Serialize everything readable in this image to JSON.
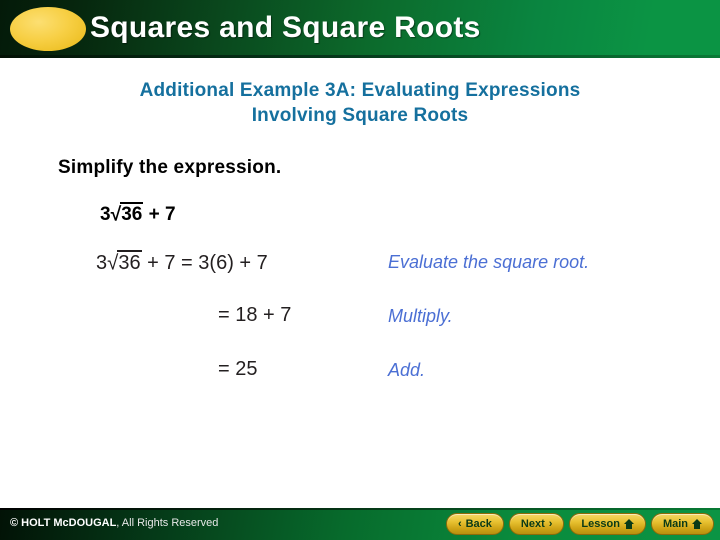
{
  "header": {
    "title": "Squares and Square Roots",
    "ellipse_color": "#f4cf45",
    "gradient_from": "#04200a",
    "gradient_to": "#0b9444"
  },
  "subtitle": {
    "line1": "Additional Example 3A: Evaluating Expressions",
    "line2": "Involving Square Roots",
    "color": "#15709e"
  },
  "lesson": {
    "prompt": "Simplify the expression.",
    "expression": {
      "coefficient": "3",
      "radical_sign": "√",
      "radicand": "36",
      "tail": " + 7"
    },
    "steps": [
      {
        "math_prefix": "3",
        "radical_sign": "√",
        "radicand": "36",
        "math_suffix": " + 7 = 3(6) + 7",
        "note": "Evaluate the square root."
      },
      {
        "math": "= 18 + 7",
        "note": "Multiply."
      },
      {
        "math": "= 25",
        "note": "Add."
      }
    ],
    "note_color": "#4b6fd4",
    "math_color": "#231f20"
  },
  "footer": {
    "copyright_brand": "© HOLT McDOUGAL",
    "copyright_rest": ", All Rights Reserved",
    "buttons": [
      {
        "label": "Back",
        "icon": "chevron-left-icon",
        "glyph": "‹"
      },
      {
        "label": "Next",
        "icon": "chevron-right-icon",
        "glyph": "›"
      },
      {
        "label": "Lesson",
        "icon": "home-icon",
        "glyph": ""
      },
      {
        "label": "Main",
        "icon": "home-icon",
        "glyph": ""
      }
    ],
    "button_color": "#e8c232"
  }
}
